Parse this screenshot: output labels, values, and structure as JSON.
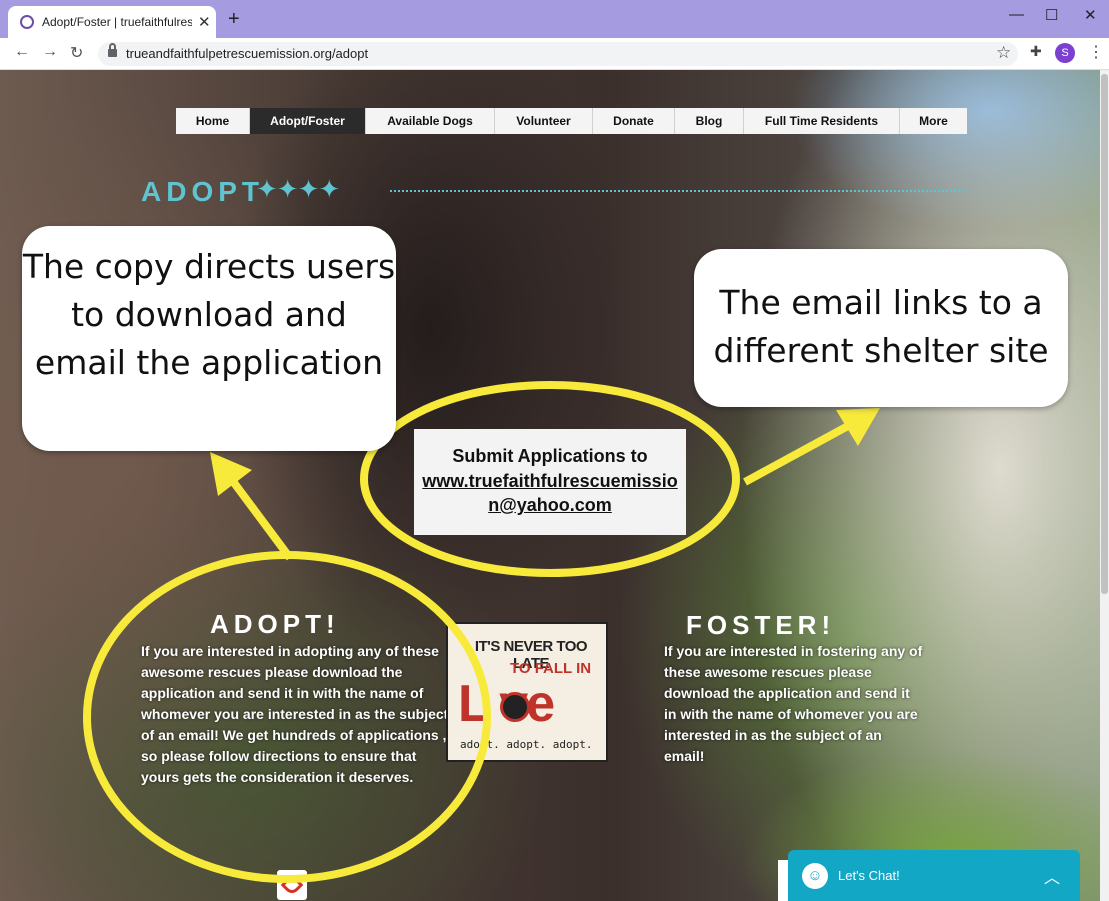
{
  "browser": {
    "tab_title": "Adopt/Foster | truefaithfulrescue",
    "tab_close": "✕",
    "new_tab": "+",
    "url": "trueandfaithfulpetrescuemission.org/adopt",
    "profile_initial": "S",
    "minimize": "—",
    "maximize": "☐",
    "close": "✕"
  },
  "site_nav": {
    "items": [
      {
        "label": "Home",
        "active": false
      },
      {
        "label": "Adopt/Foster",
        "active": true
      },
      {
        "label": "Available Dogs",
        "active": false
      },
      {
        "label": "Volunteer",
        "active": false
      },
      {
        "label": "Donate",
        "active": false
      },
      {
        "label": "Blog",
        "active": false
      },
      {
        "label": "Full Time Residents",
        "active": false
      },
      {
        "label": "More",
        "active": false
      }
    ]
  },
  "main": {
    "heading": "ADOPT",
    "heading_stars": "✦✦✦✦",
    "submit": {
      "title": "Submit Applications to",
      "email": "www.truefaithfulrescuemission@yahoo.com"
    },
    "adopt_column": {
      "heading": "ADOPT!",
      "text": "If you are interested in adopting any of these awesome rescues please download the application and send it in with the name of whomever you are interested in as the subject  of an email! We get hundreds of applications , so please follow directions to ensure that yours gets the consideration it deserves."
    },
    "foster_column": {
      "heading": "FOSTER!",
      "text": "If you are interested in fostering any of these awesome rescues please download the application and send it in with the name of whomever you are interested in as the subject  of an email!"
    },
    "love_image": {
      "line1": "IT'S NEVER TOO LATE",
      "line2": "TO FALL IN",
      "big": "L  ve",
      "footer": "adopt. adopt. adopt."
    }
  },
  "chat": {
    "label": "Let's Chat!"
  },
  "annotations": {
    "left_callout": "The copy directs users to download and email the application",
    "right_callout": "The email links to a different shelter site",
    "highlight_color": "#f7ea3b"
  },
  "colors": {
    "tab_bar": "#a49be0",
    "accent_teal": "#5fc3d0",
    "chat_blue": "#12a7c4"
  }
}
